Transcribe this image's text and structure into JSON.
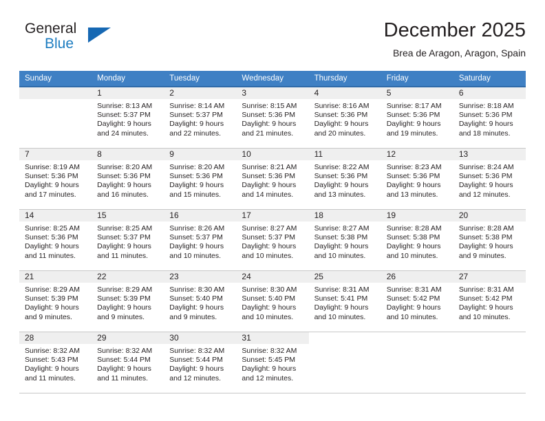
{
  "brand": {
    "name_dark": "General",
    "name_blue": "Blue",
    "accent_color": "#1668b3"
  },
  "header": {
    "month_title": "December 2025",
    "location": "Brea de Aragon, Aragon, Spain",
    "header_bg": "#3f80c4",
    "daynum_bg": "#efefef"
  },
  "weekdays": [
    "Sunday",
    "Monday",
    "Tuesday",
    "Wednesday",
    "Thursday",
    "Friday",
    "Saturday"
  ],
  "weeks": [
    [
      {
        "day": "",
        "sunrise": "",
        "sunset": "",
        "daylight1": "",
        "daylight2": ""
      },
      {
        "day": "1",
        "sunrise": "Sunrise: 8:13 AM",
        "sunset": "Sunset: 5:37 PM",
        "daylight1": "Daylight: 9 hours",
        "daylight2": "and 24 minutes."
      },
      {
        "day": "2",
        "sunrise": "Sunrise: 8:14 AM",
        "sunset": "Sunset: 5:37 PM",
        "daylight1": "Daylight: 9 hours",
        "daylight2": "and 22 minutes."
      },
      {
        "day": "3",
        "sunrise": "Sunrise: 8:15 AM",
        "sunset": "Sunset: 5:36 PM",
        "daylight1": "Daylight: 9 hours",
        "daylight2": "and 21 minutes."
      },
      {
        "day": "4",
        "sunrise": "Sunrise: 8:16 AM",
        "sunset": "Sunset: 5:36 PM",
        "daylight1": "Daylight: 9 hours",
        "daylight2": "and 20 minutes."
      },
      {
        "day": "5",
        "sunrise": "Sunrise: 8:17 AM",
        "sunset": "Sunset: 5:36 PM",
        "daylight1": "Daylight: 9 hours",
        "daylight2": "and 19 minutes."
      },
      {
        "day": "6",
        "sunrise": "Sunrise: 8:18 AM",
        "sunset": "Sunset: 5:36 PM",
        "daylight1": "Daylight: 9 hours",
        "daylight2": "and 18 minutes."
      }
    ],
    [
      {
        "day": "7",
        "sunrise": "Sunrise: 8:19 AM",
        "sunset": "Sunset: 5:36 PM",
        "daylight1": "Daylight: 9 hours",
        "daylight2": "and 17 minutes."
      },
      {
        "day": "8",
        "sunrise": "Sunrise: 8:20 AM",
        "sunset": "Sunset: 5:36 PM",
        "daylight1": "Daylight: 9 hours",
        "daylight2": "and 16 minutes."
      },
      {
        "day": "9",
        "sunrise": "Sunrise: 8:20 AM",
        "sunset": "Sunset: 5:36 PM",
        "daylight1": "Daylight: 9 hours",
        "daylight2": "and 15 minutes."
      },
      {
        "day": "10",
        "sunrise": "Sunrise: 8:21 AM",
        "sunset": "Sunset: 5:36 PM",
        "daylight1": "Daylight: 9 hours",
        "daylight2": "and 14 minutes."
      },
      {
        "day": "11",
        "sunrise": "Sunrise: 8:22 AM",
        "sunset": "Sunset: 5:36 PM",
        "daylight1": "Daylight: 9 hours",
        "daylight2": "and 13 minutes."
      },
      {
        "day": "12",
        "sunrise": "Sunrise: 8:23 AM",
        "sunset": "Sunset: 5:36 PM",
        "daylight1": "Daylight: 9 hours",
        "daylight2": "and 13 minutes."
      },
      {
        "day": "13",
        "sunrise": "Sunrise: 8:24 AM",
        "sunset": "Sunset: 5:36 PM",
        "daylight1": "Daylight: 9 hours",
        "daylight2": "and 12 minutes."
      }
    ],
    [
      {
        "day": "14",
        "sunrise": "Sunrise: 8:25 AM",
        "sunset": "Sunset: 5:36 PM",
        "daylight1": "Daylight: 9 hours",
        "daylight2": "and 11 minutes."
      },
      {
        "day": "15",
        "sunrise": "Sunrise: 8:25 AM",
        "sunset": "Sunset: 5:37 PM",
        "daylight1": "Daylight: 9 hours",
        "daylight2": "and 11 minutes."
      },
      {
        "day": "16",
        "sunrise": "Sunrise: 8:26 AM",
        "sunset": "Sunset: 5:37 PM",
        "daylight1": "Daylight: 9 hours",
        "daylight2": "and 10 minutes."
      },
      {
        "day": "17",
        "sunrise": "Sunrise: 8:27 AM",
        "sunset": "Sunset: 5:37 PM",
        "daylight1": "Daylight: 9 hours",
        "daylight2": "and 10 minutes."
      },
      {
        "day": "18",
        "sunrise": "Sunrise: 8:27 AM",
        "sunset": "Sunset: 5:38 PM",
        "daylight1": "Daylight: 9 hours",
        "daylight2": "and 10 minutes."
      },
      {
        "day": "19",
        "sunrise": "Sunrise: 8:28 AM",
        "sunset": "Sunset: 5:38 PM",
        "daylight1": "Daylight: 9 hours",
        "daylight2": "and 10 minutes."
      },
      {
        "day": "20",
        "sunrise": "Sunrise: 8:28 AM",
        "sunset": "Sunset: 5:38 PM",
        "daylight1": "Daylight: 9 hours",
        "daylight2": "and 9 minutes."
      }
    ],
    [
      {
        "day": "21",
        "sunrise": "Sunrise: 8:29 AM",
        "sunset": "Sunset: 5:39 PM",
        "daylight1": "Daylight: 9 hours",
        "daylight2": "and 9 minutes."
      },
      {
        "day": "22",
        "sunrise": "Sunrise: 8:29 AM",
        "sunset": "Sunset: 5:39 PM",
        "daylight1": "Daylight: 9 hours",
        "daylight2": "and 9 minutes."
      },
      {
        "day": "23",
        "sunrise": "Sunrise: 8:30 AM",
        "sunset": "Sunset: 5:40 PM",
        "daylight1": "Daylight: 9 hours",
        "daylight2": "and 9 minutes."
      },
      {
        "day": "24",
        "sunrise": "Sunrise: 8:30 AM",
        "sunset": "Sunset: 5:40 PM",
        "daylight1": "Daylight: 9 hours",
        "daylight2": "and 10 minutes."
      },
      {
        "day": "25",
        "sunrise": "Sunrise: 8:31 AM",
        "sunset": "Sunset: 5:41 PM",
        "daylight1": "Daylight: 9 hours",
        "daylight2": "and 10 minutes."
      },
      {
        "day": "26",
        "sunrise": "Sunrise: 8:31 AM",
        "sunset": "Sunset: 5:42 PM",
        "daylight1": "Daylight: 9 hours",
        "daylight2": "and 10 minutes."
      },
      {
        "day": "27",
        "sunrise": "Sunrise: 8:31 AM",
        "sunset": "Sunset: 5:42 PM",
        "daylight1": "Daylight: 9 hours",
        "daylight2": "and 10 minutes."
      }
    ],
    [
      {
        "day": "28",
        "sunrise": "Sunrise: 8:32 AM",
        "sunset": "Sunset: 5:43 PM",
        "daylight1": "Daylight: 9 hours",
        "daylight2": "and 11 minutes."
      },
      {
        "day": "29",
        "sunrise": "Sunrise: 8:32 AM",
        "sunset": "Sunset: 5:44 PM",
        "daylight1": "Daylight: 9 hours",
        "daylight2": "and 11 minutes."
      },
      {
        "day": "30",
        "sunrise": "Sunrise: 8:32 AM",
        "sunset": "Sunset: 5:44 PM",
        "daylight1": "Daylight: 9 hours",
        "daylight2": "and 12 minutes."
      },
      {
        "day": "31",
        "sunrise": "Sunrise: 8:32 AM",
        "sunset": "Sunset: 5:45 PM",
        "daylight1": "Daylight: 9 hours",
        "daylight2": "and 12 minutes."
      },
      {
        "day": "",
        "sunrise": "",
        "sunset": "",
        "daylight1": "",
        "daylight2": ""
      },
      {
        "day": "",
        "sunrise": "",
        "sunset": "",
        "daylight1": "",
        "daylight2": ""
      },
      {
        "day": "",
        "sunrise": "",
        "sunset": "",
        "daylight1": "",
        "daylight2": ""
      }
    ]
  ]
}
